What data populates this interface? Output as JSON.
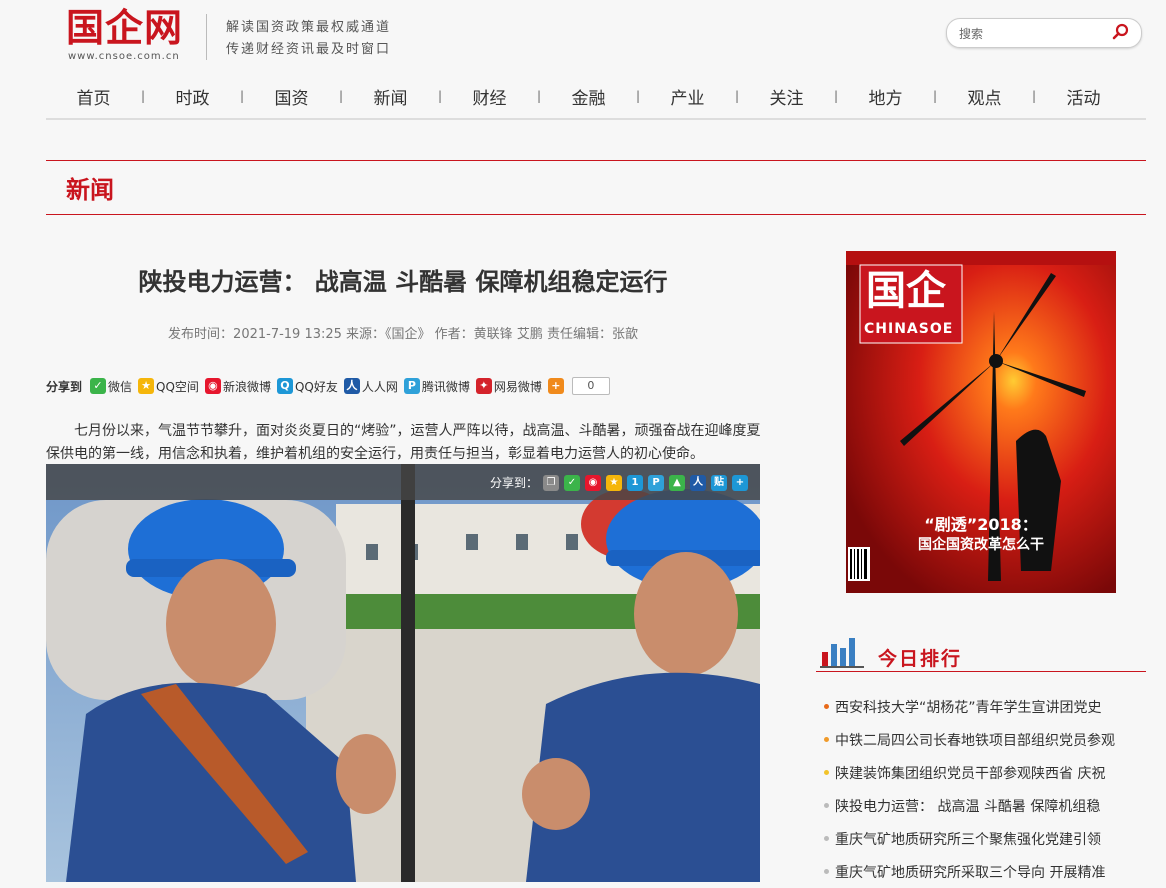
{
  "header": {
    "logo_text": "国企网",
    "logo_url": "www.cnsoe.com.cn",
    "slogan_line1": "解读国资政策最权威通道",
    "slogan_line2": "传递财经资讯最及时窗口",
    "search_placeholder": "搜索"
  },
  "nav": {
    "items": [
      "首页",
      "时政",
      "国资",
      "新闻",
      "财经",
      "金融",
      "产业",
      "关注",
      "地方",
      "观点",
      "活动"
    ],
    "separator": "|"
  },
  "section": {
    "title": "新闻"
  },
  "article": {
    "title": "陕投电力运营： 战高温 斗酷暑 保障机组稳定运行",
    "meta": "发布时间：2021-7-19 13:25 来源：《国企》 作者：黄联锋 艾鹏 责任编辑：张歆",
    "share_label": "分享到",
    "share_items": [
      {
        "label": "微信",
        "icon": "wechat-icon",
        "color": "#3bb44a"
      },
      {
        "label": "QQ空间",
        "icon": "qzone-icon",
        "color": "#f5b60b"
      },
      {
        "label": "新浪微博",
        "icon": "weibo-icon",
        "color": "#e6162d"
      },
      {
        "label": "QQ好友",
        "icon": "qq-icon",
        "color": "#1d97d6"
      },
      {
        "label": "人人网",
        "icon": "renren-icon",
        "color": "#1f5aa6"
      },
      {
        "label": "腾讯微博",
        "icon": "tencent-weibo-icon",
        "color": "#2fa1d9"
      },
      {
        "label": "网易微博",
        "icon": "netease-weibo-icon",
        "color": "#d4232b"
      }
    ],
    "share_count": "0",
    "paragraph": "七月份以来，气温节节攀升，面对炎炎夏日的“烤验”，运营人严阵以待，战高温、斗酷暑，顽强奋战在迎峰度夏保供电的第一线，用信念和执着，维护着机组的安全运行，用责任与担当，彰显着电力运营人的初心使命。",
    "photo_share_label": "分享到："
  },
  "sidebar": {
    "cover": {
      "masthead": "国企",
      "masthead_en": "CHINASOE",
      "headline_line1": "“剧透”2018：",
      "headline_line2": "国企国资改革怎么干"
    },
    "ranking": {
      "title": "今日排行",
      "items": [
        {
          "text": "西安科技大学“胡杨花”青年学生宣讲团党史",
          "dot_color": "#e86a1a"
        },
        {
          "text": "中铁二局四公司长春地铁项目部组织党员参观",
          "dot_color": "#f09a2a"
        },
        {
          "text": "陕建装饰集团组织党员干部参观陕西省 庆祝",
          "dot_color": "#f2c32a"
        },
        {
          "text": "陕投电力运营： 战高温 斗酷暑 保障机组稳",
          "dot_color": "#bbbbbb"
        },
        {
          "text": "重庆气矿地质研究所三个聚焦强化党建引领",
          "dot_color": "#bbbbbb"
        },
        {
          "text": "重庆气矿地质研究所采取三个导向 开展精准",
          "dot_color": "#bbbbbb"
        }
      ]
    }
  },
  "colors": {
    "brand_red": "#c9151e"
  }
}
